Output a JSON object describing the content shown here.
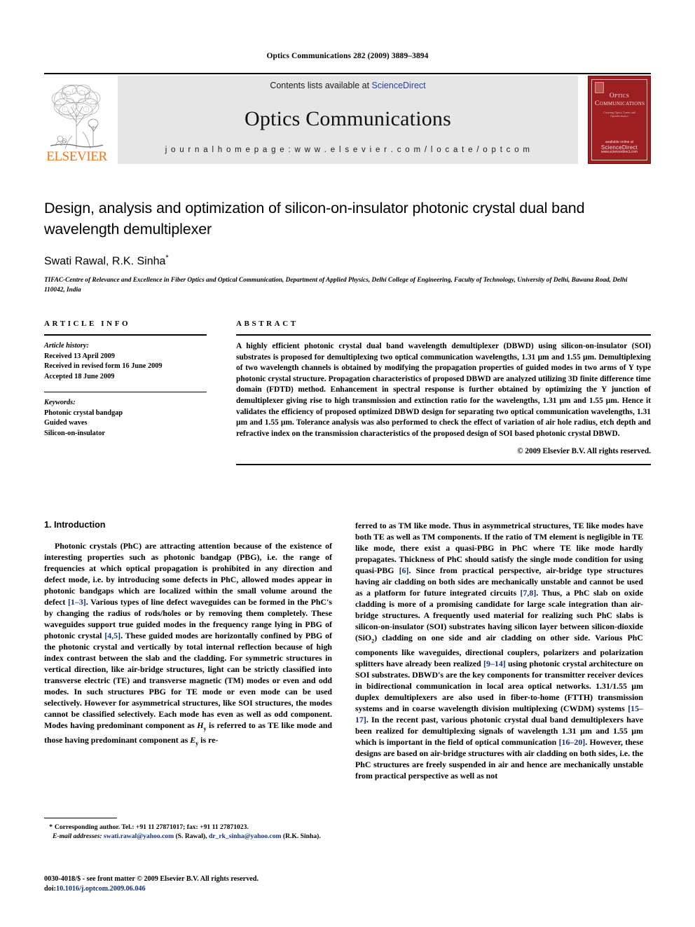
{
  "running_head": "Optics Communications 282 (2009) 3889–3894",
  "masthead": {
    "publisher_wordmark": "ELSEVIER",
    "contents_prefix": "Contents lists available at ",
    "contents_link": "ScienceDirect",
    "journal_name": "Optics Communications",
    "homepage_line": "j o u r n a l   h o m e p a g e :   w w w . e l s e v i e r . c o m / l o c a t e / o p t c o m",
    "cover": {
      "title_line1": "Optics",
      "title_line2": "Communications",
      "subtitle": "Covering Optics, Lasers and Optoelectronics",
      "footer_small": "available online at",
      "footer_big": "ScienceDirect",
      "footer_tiny": "www.sciencedirect.com"
    }
  },
  "article": {
    "title": "Design, analysis and optimization of silicon-on-insulator photonic crystal dual band wavelength demultiplexer",
    "authors": "Swati Rawal, R.K. Sinha",
    "corresponding_marker": "*",
    "affiliation": "TIFAC-Centre of Relevance and Excellence in Fiber Optics and Optical Communication, Department of Applied Physics, Delhi College of Engineering, Faculty of Technology, University of Delhi, Bawana Road, Delhi 110042, India"
  },
  "article_info": {
    "heading": "ARTICLE INFO",
    "history_label": "Article history:",
    "history": [
      "Received 13 April 2009",
      "Received in revised form 16 June 2009",
      "Accepted 18 June 2009"
    ],
    "keywords_label": "Keywords:",
    "keywords": [
      "Photonic crystal bandgap",
      "Guided waves",
      "Silicon-on-insulator"
    ]
  },
  "abstract": {
    "heading": "ABSTRACT",
    "text": "A highly efficient photonic crystal dual band wavelength demultiplexer (DBWD) using silicon-on-insulator (SOI) substrates is proposed for demultiplexing two optical communication wavelengths, 1.31 µm and 1.55 µm. Demultiplexing of two wavelength channels is obtained by modifying the propagation properties of guided modes in two arms of Y type photonic crystal structure. Propagation characteristics of proposed DBWD are analyzed utilizing 3D finite difference time domain (FDTD) method. Enhancement in spectral response is further obtained by optimizing the Y junction of demultiplexer giving rise to high transmission and extinction ratio for the wavelengths, 1.31 µm and 1.55 µm. Hence it validates the efficiency of proposed optimized DBWD design for separating two optical communication wavelengths, 1.31 µm and 1.55 µm. Tolerance analysis was also performed to check the effect of variation of air hole radius, etch depth and refractive index on the transmission characteristics of the proposed design of SOI based photonic crystal DBWD.",
    "copyright": "© 2009 Elsevier B.V. All rights reserved."
  },
  "body": {
    "section_heading": "1. Introduction",
    "left_paragraph_1_a": "Photonic crystals (PhC) are attracting attention because of the existence of interesting properties such as photonic bandgap (PBG), i.e. the range of frequencies at which optical propagation is prohibited in any direction and defect mode, i.e. by introducing some defects in PhC, allowed modes appear in photonic bandgaps which are localized within the small volume around the defect ",
    "ref_1_3": "[1–3]",
    "left_paragraph_1_b": ". Various types of line defect waveguides can be formed in the PhC's by changing the radius of rods/holes or by removing them completely. These waveguides support true guided modes in the frequency range lying in PBG of photonic crystal ",
    "ref_4_5": "[4,5]",
    "left_paragraph_1_c": ". These guided modes are horizontally confined by PBG of the photonic crystal and vertically by total internal reflection because of high index contrast between the slab and the cladding. For symmetric structures in vertical direction, like air-bridge structures, light can be strictly classified into transverse electric (TE) and transverse magnetic (TM) modes or even and odd modes. In such structures PBG for TE mode or even mode can be used selectively. However for asymmetrical structures, like SOI structures, the modes cannot be classified selectively. Each mode has even as well as odd component. Modes having predominant component as ",
    "sym_hy": "H",
    "sym_hy_sub": "y",
    "left_paragraph_1_d": " is referred to as TE like mode and those having predominant component as ",
    "sym_ey": "E",
    "sym_ey_sub": "y",
    "left_paragraph_1_e": " is re-",
    "right_paragraph_a": "ferred to as TM like mode. Thus in asymmetrical structures, TE like modes have both TE as well as TM components. If the ratio of TM element is negligible in TE like mode, there exist a quasi-PBG in PhC where TE like mode hardly propagates. Thickness of PhC should satisfy the single mode condition for using quasi-PBG ",
    "ref_6": "[6]",
    "right_paragraph_b": ". Since from practical perspective, air-bridge type structures having air cladding on both sides are mechanically unstable and cannot be used as a platform for future integrated circuits ",
    "ref_7_8": "[7,8]",
    "right_paragraph_c": ". Thus, a PhC slab on oxide cladding is more of a promising candidate for large scale integration than air-bridge structures. A frequently used material for realizing such PhC slabs is silicon-on-insulator (SOI) substrates having silicon layer between silicon-dioxide (SiO",
    "sio2_sub": "2",
    "right_paragraph_d": ") cladding on one side and air cladding on other side. Various PhC components like waveguides, directional couplers, polarizers and polarization splitters have already been realized ",
    "ref_9_14": "[9–14]",
    "right_paragraph_e": " using photonic crystal architecture on SOI substrates. DBWD's are the key components for transmitter receiver devices in bidirectional communication in local area optical networks. 1.31/1.55 µm duplex demultiplexers are also used in fiber-to-home (FTTH) transmission systems and in coarse wavelength division multiplexing (CWDM) systems ",
    "ref_15_17": "[15–17]",
    "right_paragraph_f": ". In the recent past, various photonic crystal dual band demultiplexers have been realized for demultiplexing signals of wavelength 1.31 µm and 1.55 µm which is important in the field of optical communication ",
    "ref_16_20": "[16–20]",
    "right_paragraph_g": ". However, these designs are based on air-bridge structures with air cladding on both sides, i.e. the PhC structures are freely suspended in air and hence are mechanically unstable from practical perspective as well as not"
  },
  "footnote": {
    "marker": "*",
    "corresponding": "Corresponding author. Tel.: +91 11 27871017; fax: +91 11 27871023.",
    "email_label": "E-mail addresses:",
    "email_1": "swati.rawal@yahoo.com",
    "email_1_owner": " (S. Rawal), ",
    "email_2": "dr_rk_sinha@yahoo.com",
    "email_2_owner": " (R.K. Sinha)."
  },
  "imprint": {
    "issn_line": "0030-4018/$ - see front matter © 2009 Elsevier B.V. All rights reserved.",
    "doi_label": "doi:",
    "doi_value": "10.1016/j.optcom.2009.06.046"
  },
  "colors": {
    "link_blue": "#14307a",
    "sciencedirect_blue": "#2b3f9e",
    "elsevier_orange": "#E87722",
    "cover_red": "#9d1f22",
    "band_grey": "#e6e6e6"
  }
}
